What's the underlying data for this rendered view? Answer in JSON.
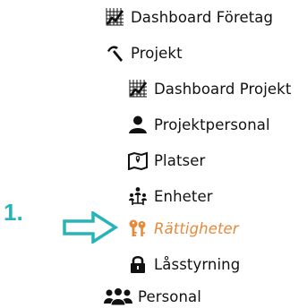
{
  "annotation": {
    "step_label": "1.",
    "color": "#27b3b8"
  },
  "menu": {
    "accent_color": "#e6893a",
    "items": [
      {
        "label": "Dashboard Företag",
        "icon": "chart-grid-icon"
      },
      {
        "label": "Projekt",
        "icon": "hammer-icon"
      },
      {
        "label": "Dashboard Projekt",
        "icon": "chart-grid-icon"
      },
      {
        "label": "Projektpersonal",
        "icon": "person-icon"
      },
      {
        "label": "Platser",
        "icon": "map-marker-icon"
      },
      {
        "label": "Enheter",
        "icon": "network-icon"
      },
      {
        "label": "Rättigheter",
        "icon": "keys-icon",
        "active": true
      },
      {
        "label": "Låsstyrning",
        "icon": "lock-icon"
      },
      {
        "label": "Personal",
        "icon": "people-icon"
      }
    ]
  }
}
